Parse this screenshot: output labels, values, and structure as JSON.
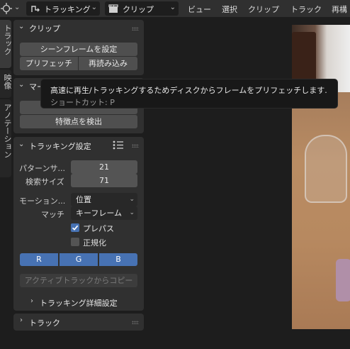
{
  "header": {
    "tool_icon": "crosshair-icon",
    "mode_label": "トラッキング",
    "mode_icon": "tracking-icon",
    "clip_label": "クリップ",
    "clip_icon": "clapper-icon",
    "menus": [
      "ビュー",
      "選択",
      "クリップ",
      "トラック",
      "再構"
    ]
  },
  "vertical_tabs": [
    "トラック",
    "映像",
    "アノテーション"
  ],
  "clip_panel": {
    "title": "クリップ",
    "set_scene_frames": "シーンフレームを設定",
    "prefetch": "プリフェッチ",
    "reload": "再読み込み"
  },
  "marker_panel": {
    "title_partial": "マー",
    "detect_features": "特徴点を検出"
  },
  "tooltip": {
    "description": "高速に再生/トラッキングするためディスクからフレームをプリフェッチします.",
    "shortcut": "ショートカット: P"
  },
  "tracking_settings": {
    "title": "トラッキング設定",
    "pattern_size_label": "パターンサ...",
    "pattern_size_value": "21",
    "search_size_label": "検索サイズ",
    "search_size_value": "71",
    "motion_label": "モーション...",
    "motion_value": "位置",
    "match_label": "マッチ",
    "match_value": "キーフレーム",
    "prepass_label": "プレパス",
    "prepass_checked": true,
    "normalize_label": "正規化",
    "normalize_checked": false,
    "channels": [
      "R",
      "G",
      "B"
    ],
    "copy_from_active": "アクティブトラックからコピー",
    "advanced": "トラッキング詳細設定"
  },
  "track_panel": {
    "title": "トラック"
  },
  "colors": {
    "accent": "#4772b3",
    "panel": "#303030",
    "button": "#4f4f4f"
  }
}
